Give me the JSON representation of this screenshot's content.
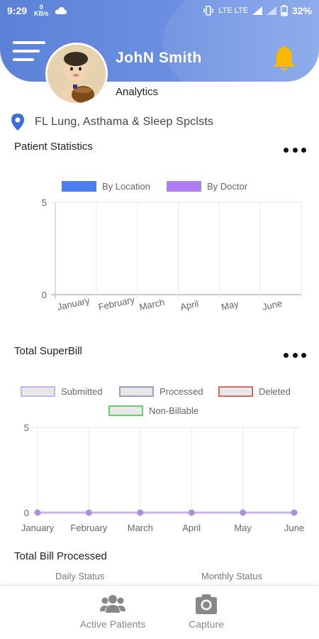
{
  "status_bar": {
    "time": "9:29",
    "data_speed": "0",
    "data_unit": "KB/s",
    "network": "LTE LTE",
    "battery": "32%"
  },
  "header": {
    "user_name": "JohN Smith",
    "page_subtitle": "Analytics",
    "menu_icon": "hamburger-icon",
    "bell_icon": "bell-icon"
  },
  "location": {
    "icon": "location-pin-icon",
    "name": "FL Lung, Asthama & Sleep Spclsts"
  },
  "colors": {
    "header": "#6c8fe0",
    "by_location": "#4d7ef0",
    "by_doctor": "#b07ef0",
    "bell": "#f6b800"
  },
  "patient_statistics": {
    "title": "Patient Statistics",
    "legend": [
      "By Location",
      "By Doctor"
    ]
  },
  "total_superbill": {
    "title": "Total SuperBill",
    "legend": [
      "Submitted",
      "Processed",
      "Deleted",
      "Non-Billable"
    ]
  },
  "total_bill_processed": {
    "title": "Total Bill Processed",
    "daily": "Daily Status",
    "monthly": "Monthly Status"
  },
  "bottom_nav": {
    "active_patients": "Active Patients",
    "capture": "Capture"
  },
  "chart_data": [
    {
      "type": "bar",
      "title": "Patient Statistics",
      "categories": [
        "January",
        "February",
        "March",
        "April",
        "May",
        "June"
      ],
      "series": [
        {
          "name": "By Location",
          "values": [
            0,
            0,
            0,
            0,
            0,
            0
          ]
        },
        {
          "name": "By Doctor",
          "values": [
            0,
            0,
            0,
            0,
            0,
            0
          ]
        }
      ],
      "ylim": [
        0,
        5
      ],
      "y_ticks": [
        "0",
        "5"
      ],
      "grid": true,
      "legend": "top"
    },
    {
      "type": "line",
      "title": "Total SuperBill",
      "categories": [
        "January",
        "February",
        "March",
        "April",
        "May",
        "June"
      ],
      "series": [
        {
          "name": "Submitted",
          "values": [
            0,
            0,
            0,
            0,
            0,
            0
          ]
        },
        {
          "name": "Processed",
          "values": [
            0,
            0,
            0,
            0,
            0,
            0
          ]
        },
        {
          "name": "Deleted",
          "values": [
            0,
            0,
            0,
            0,
            0,
            0
          ]
        },
        {
          "name": "Non-Billable",
          "values": [
            0,
            0,
            0,
            0,
            0,
            0
          ]
        }
      ],
      "ylim": [
        0,
        5
      ],
      "y_ticks": [
        "0",
        "5"
      ],
      "grid": true,
      "legend": "top"
    }
  ]
}
